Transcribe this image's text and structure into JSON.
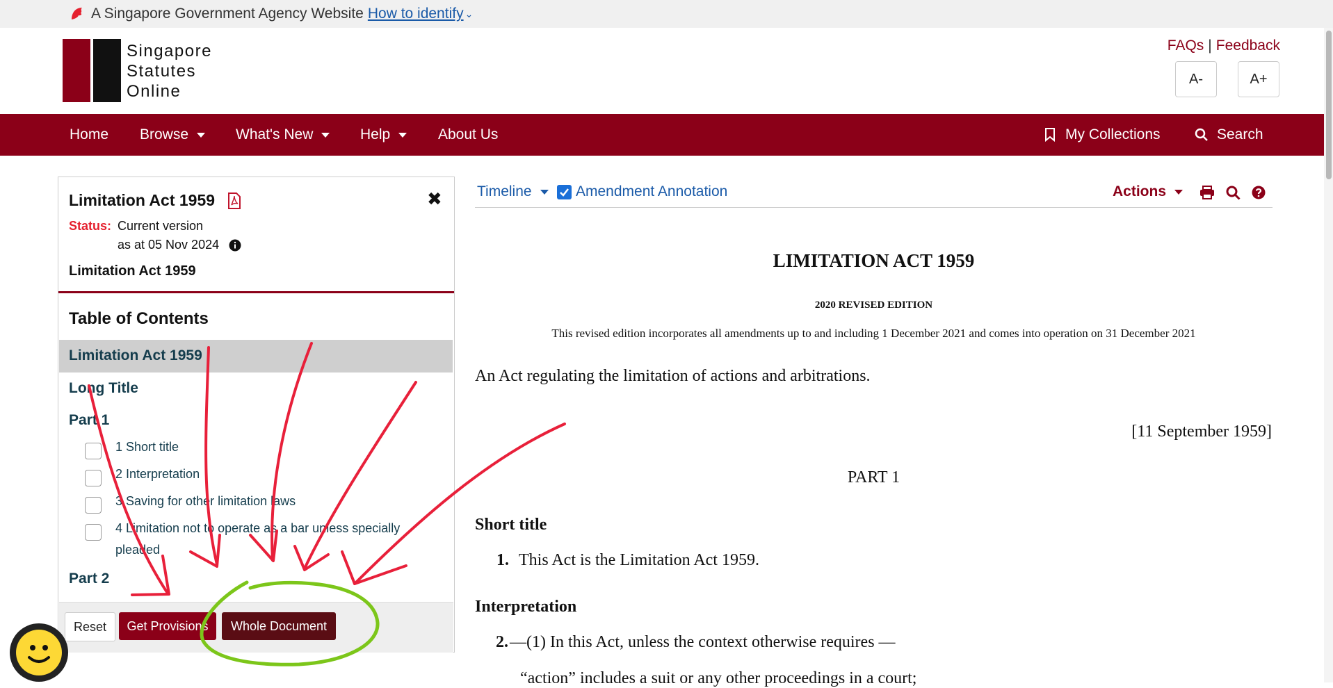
{
  "masthead": {
    "agency_text": "A Singapore Government Agency Website",
    "identify_link": "How to identify"
  },
  "header": {
    "logo_lines": [
      "Singapore",
      "Statutes",
      "Online"
    ],
    "faqs": "FAQs",
    "separator": "|",
    "feedback": "Feedback",
    "font_decrease": "A-",
    "font_increase": "A+"
  },
  "nav": {
    "home": "Home",
    "browse": "Browse",
    "whats_new": "What's New",
    "help": "Help",
    "about": "About Us",
    "collections": "My Collections",
    "search": "Search"
  },
  "sidebar": {
    "act_title": "Limitation Act 1959",
    "status_label": "Status:",
    "status_value": "Current version",
    "as_at": "as at 05 Nov 2024",
    "act_title_2": "Limitation Act 1959",
    "toc_heading": "Table of Contents",
    "toc": {
      "active": "Limitation Act 1959",
      "long_title": "Long Title",
      "part1": "Part 1",
      "items": [
        "1 Short title",
        "2 Interpretation",
        "3 Saving for other limitation laws",
        "4 Limitation not to operate as a bar unless specially",
        "pleaded"
      ],
      "part2": "Part 2"
    },
    "buttons": {
      "reset": "Reset",
      "get_provisions": "Get Provisions",
      "whole_document": "Whole Document"
    }
  },
  "toolbar": {
    "timeline": "Timeline",
    "amendment_annotation": "Amendment Annotation",
    "annotation_checked": true,
    "actions": "Actions"
  },
  "document": {
    "title": "LIMITATION ACT 1959",
    "edition": "2020 REVISED EDITION",
    "revision_note": "This revised edition incorporates all amendments up to and including 1 December 2021 and comes into operation on 31 December 2021",
    "long_title": "An Act regulating the limitation of actions and arbitrations.",
    "date": "[11 September 1959]",
    "part": "PART 1",
    "s1_heading": "Short title",
    "s1_num": "1.",
    "s1_text": "This Act is the Limitation Act 1959.",
    "s2_heading": "Interpretation",
    "s2_num": "2.",
    "s2_text": "—(1)  In this Act, unless the context otherwise requires —",
    "s2_def": "“action” includes a suit or any other proceedings in a court;"
  },
  "colors": {
    "brand": "#8b0018",
    "link": "#1a5aa8",
    "annotation_red": "#e8203a",
    "annotation_green": "#7cc61a"
  }
}
